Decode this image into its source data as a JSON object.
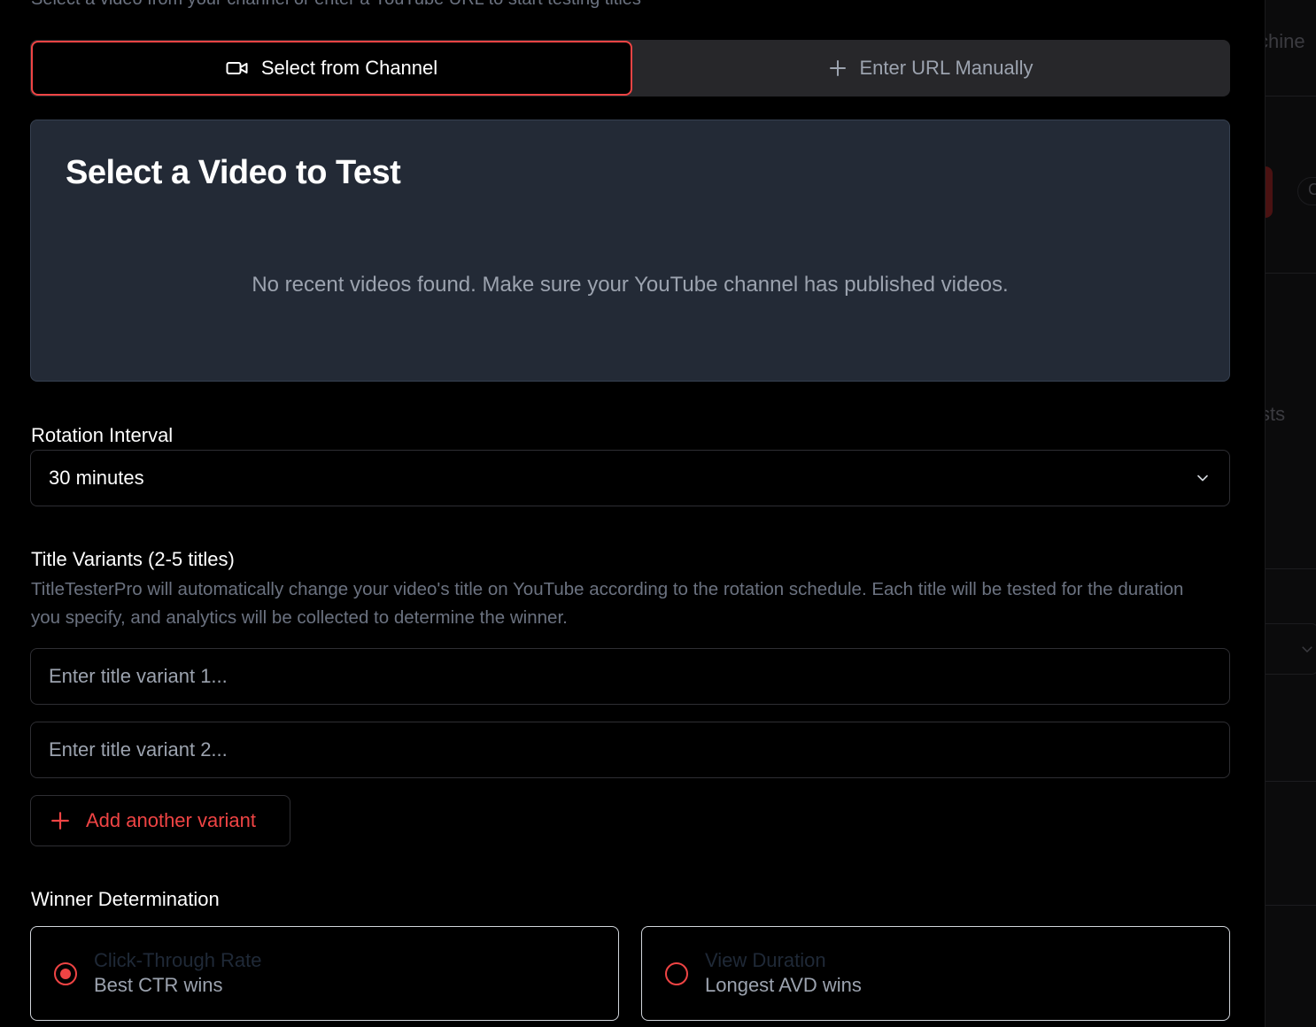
{
  "header": {
    "subtitle": "Select a video from your channel or enter a YouTube URL to start testing titles"
  },
  "source_tabs": [
    {
      "label": "Select from Channel",
      "icon": "video-camera-icon",
      "active": true
    },
    {
      "label": "Enter URL Manually",
      "icon": "plus-icon",
      "active": false
    }
  ],
  "video_picker": {
    "title": "Select a Video to Test",
    "empty_message": "No recent videos found. Make sure your YouTube channel has published videos."
  },
  "rotation": {
    "label": "Rotation Interval",
    "selected": "30 minutes"
  },
  "variants": {
    "label": "Title Variants (2-5 titles)",
    "help": "TitleTesterPro will automatically change your video's title on YouTube according to the rotation schedule. Each title will be tested for the duration you specify, and analytics will be collected to determine the winner.",
    "inputs": [
      {
        "value": "",
        "placeholder": "Enter title variant 1..."
      },
      {
        "value": "",
        "placeholder": "Enter title variant 2..."
      }
    ],
    "add_label": "Add another variant"
  },
  "winner": {
    "label": "Winner Determination",
    "options": [
      {
        "title": "Click-Through Rate",
        "subtitle": "Best CTR wins",
        "selected": true
      },
      {
        "title": "View Duration",
        "subtitle": "Longest AVD wins",
        "selected": false
      }
    ]
  },
  "background_page": {
    "fragments": [
      "chine",
      "C",
      "sts"
    ]
  },
  "colors": {
    "accent": "#ef4444",
    "card_bg": "#232a36",
    "tab_bg": "#27272a",
    "muted_text": "#9ca3af"
  }
}
